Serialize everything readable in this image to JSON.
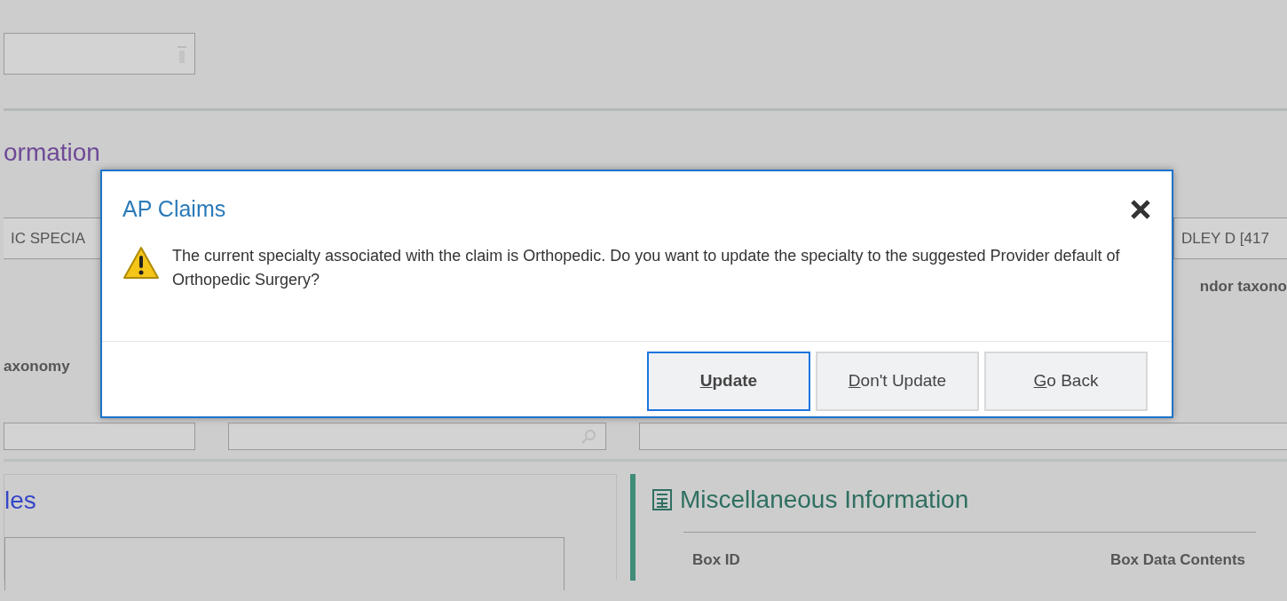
{
  "page": {
    "heading_1": "ormation",
    "specialty_field": "IC SPECIA",
    "provider_field": "DLEY D [417",
    "label_right": "ndor taxono",
    "label_left": "axonomy",
    "heading_2": "les",
    "heading_3": "Miscellaneous Information",
    "table_columns": [
      "Box ID",
      "Box Data Contents"
    ]
  },
  "dialog": {
    "title": "AP Claims",
    "message": "The current specialty associated with the claim is Orthopedic. Do you want to update the specialty to the suggested Provider default of Orthopedic Surgery?",
    "buttons": [
      {
        "label": "Update",
        "default": true,
        "underline_first": true
      },
      {
        "label": "Don't Update",
        "default": false,
        "underline_first": true
      },
      {
        "label": "Go Back",
        "default": false,
        "underline_first": true
      }
    ]
  }
}
